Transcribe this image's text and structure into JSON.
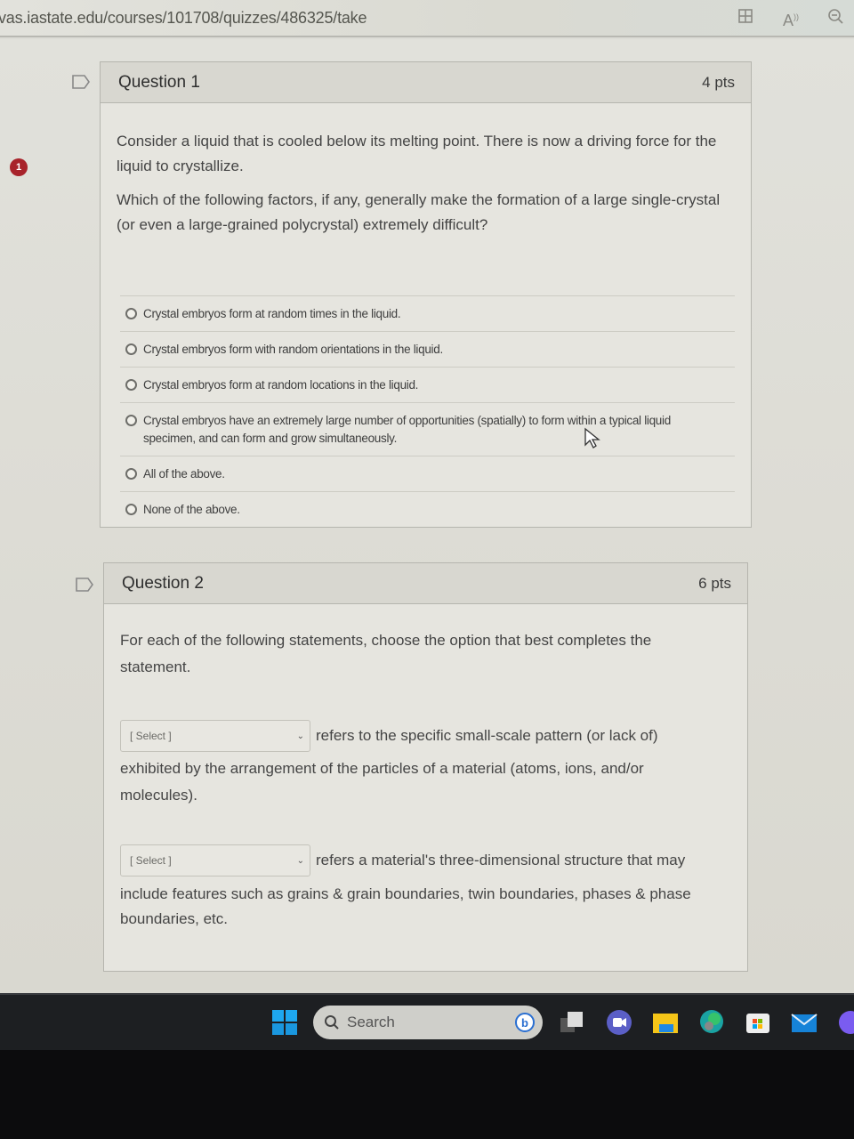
{
  "browser": {
    "url": "vas.iastate.edu/courses/101708/quizzes/486325/take",
    "toolbar_icons": [
      "split-screen-icon",
      "read-aloud-icon",
      "zoom-out-icon"
    ]
  },
  "alert_badge": "1",
  "questions": [
    {
      "title": "Question 1",
      "points": "4 pts",
      "paragraphs": [
        "Consider a liquid that is cooled below its melting point. There is now a driving force for the liquid to crystallize.",
        "Which of the following factors, if any, generally make the formation of a large single-crystal (or even a large-grained polycrystal) extremely difficult?"
      ],
      "answers": [
        "Crystal embryos form at random times in the liquid.",
        "Crystal embryos form with random orientations in the liquid.",
        "Crystal embryos form at random locations in the liquid.",
        "Crystal embryos have an extremely large number of opportunities (spatially) to form within a typical liquid specimen, and can form and grow simultaneously.",
        "All of the above.",
        "None of the above."
      ]
    },
    {
      "title": "Question 2",
      "points": "6 pts",
      "intro": "For each of the following statements, choose the option that best completes the statement.",
      "blanks": [
        {
          "select_value": "[ Select ]",
          "text_first": "refers to the specific small-scale pattern (or lack of)",
          "text_rest": "exhibited by the arrangement of the particles of a material (atoms, ions, and/or molecules)."
        },
        {
          "select_value": "[ Select ]",
          "text_first": "refers a material's three-dimensional structure that may",
          "text_rest": "include features such as grains & grain boundaries, twin boundaries, phases & phase boundaries, etc."
        }
      ]
    }
  ],
  "taskbar": {
    "search_label": "Search",
    "apps": [
      "start-icon",
      "bing-icon",
      "task-view-icon",
      "teams-meet-icon",
      "file-explorer-icon",
      "edge-icon",
      "store-icon",
      "mail-icon",
      "copilot-icon"
    ]
  }
}
